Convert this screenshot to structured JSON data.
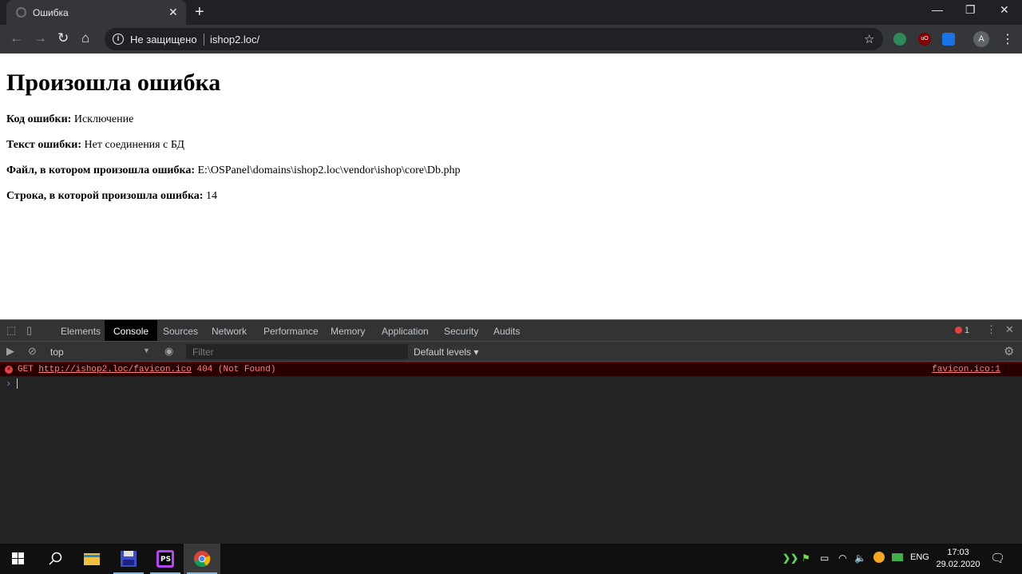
{
  "browser": {
    "tab": {
      "title": "Ошибка"
    },
    "omnibox": {
      "security_label": "Не защищено",
      "url": "ishop2.loc/"
    },
    "profile_initial": "A"
  },
  "page": {
    "heading": "Произошла ошибка",
    "rows": [
      {
        "label": "Код ошибки:",
        "value": "Исключение"
      },
      {
        "label": "Текст ошибки:",
        "value": "Нет соединения с БД"
      },
      {
        "label": "Файл, в котором произошла ошибка:",
        "value": "E:\\OSPanel\\domains\\ishop2.loc\\vendor\\ishop\\core\\Db.php"
      },
      {
        "label": "Строка, в которой произошла ошибка:",
        "value": "14"
      }
    ]
  },
  "devtools": {
    "tabs": [
      "Elements",
      "Console",
      "Sources",
      "Network",
      "Performance",
      "Memory",
      "Application",
      "Security",
      "Audits"
    ],
    "active_tab": "Console",
    "error_count": "1",
    "context": "top",
    "filter_placeholder": "Filter",
    "levels_label": "Default levels",
    "console_error": {
      "method": "GET",
      "url": "http://ishop2.loc/favicon.ico",
      "status": "404 (Not Found)",
      "source": "favicon.ico:1"
    }
  },
  "taskbar": {
    "language": "ENG",
    "time": "17:03",
    "date": "29.02.2020"
  },
  "colors": {
    "error_text": "#fe8080",
    "error_bg": "#290000",
    "taskbar_running": "#76b9ed"
  }
}
